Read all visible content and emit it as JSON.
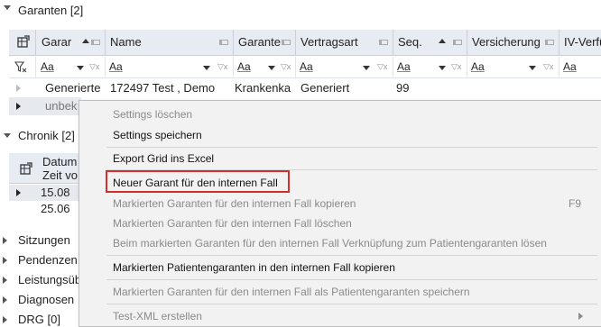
{
  "garanten": {
    "title": "Garanten [2]",
    "columns": [
      "Garar",
      "Name",
      "Garante",
      "Vertragsart",
      "Seq.",
      "Versicherung",
      "IV-Verfü"
    ],
    "filter_placeholder": "Aa",
    "rows": [
      {
        "cells": [
          "Generierte",
          "172497 Test , Demo",
          "Krankenka",
          "Generiert",
          "99"
        ]
      },
      {
        "cells": [
          "unbek"
        ]
      }
    ]
  },
  "chronik": {
    "title": "Chronik [2]",
    "header_line1": "Datum",
    "header_line2": "Zeit vo",
    "rows": [
      "15.08",
      "25.06"
    ]
  },
  "tree_sections": [
    "Sitzungen",
    "Pendenzen",
    "Leistungsüb",
    "Diagnosen",
    "DRG [0]"
  ],
  "context_menu": {
    "items": [
      {
        "label": "Settings löschen",
        "enabled": false
      },
      {
        "label": "Settings speichern",
        "enabled": true
      },
      {
        "label": "Export Grid ins Excel",
        "enabled": true
      },
      {
        "label": "Neuer Garant für den internen Fall",
        "enabled": true,
        "highlighted": true
      },
      {
        "label": "Markierten Garanten für den internen Fall kopieren",
        "enabled": false,
        "shortcut": "F9"
      },
      {
        "label": "Markierten Garanten für den internen Fall löschen",
        "enabled": false
      },
      {
        "label": "Beim markierten Garanten für den internen Fall Verknüpfung zum Patientengaranten lösen",
        "enabled": false
      },
      {
        "label": "Markierten Patientengaranten in den internen Fall kopieren",
        "enabled": true
      },
      {
        "label": "Markierten Garanten für den internen Fall als Patientengaranten speichern",
        "enabled": false
      },
      {
        "label": "Test-XML erstellen",
        "enabled": false
      }
    ]
  },
  "colors": {
    "highlight_border": "#d32f2f",
    "header_bg": "#e7ebf2",
    "menu_bg": "#f2f2f2"
  }
}
